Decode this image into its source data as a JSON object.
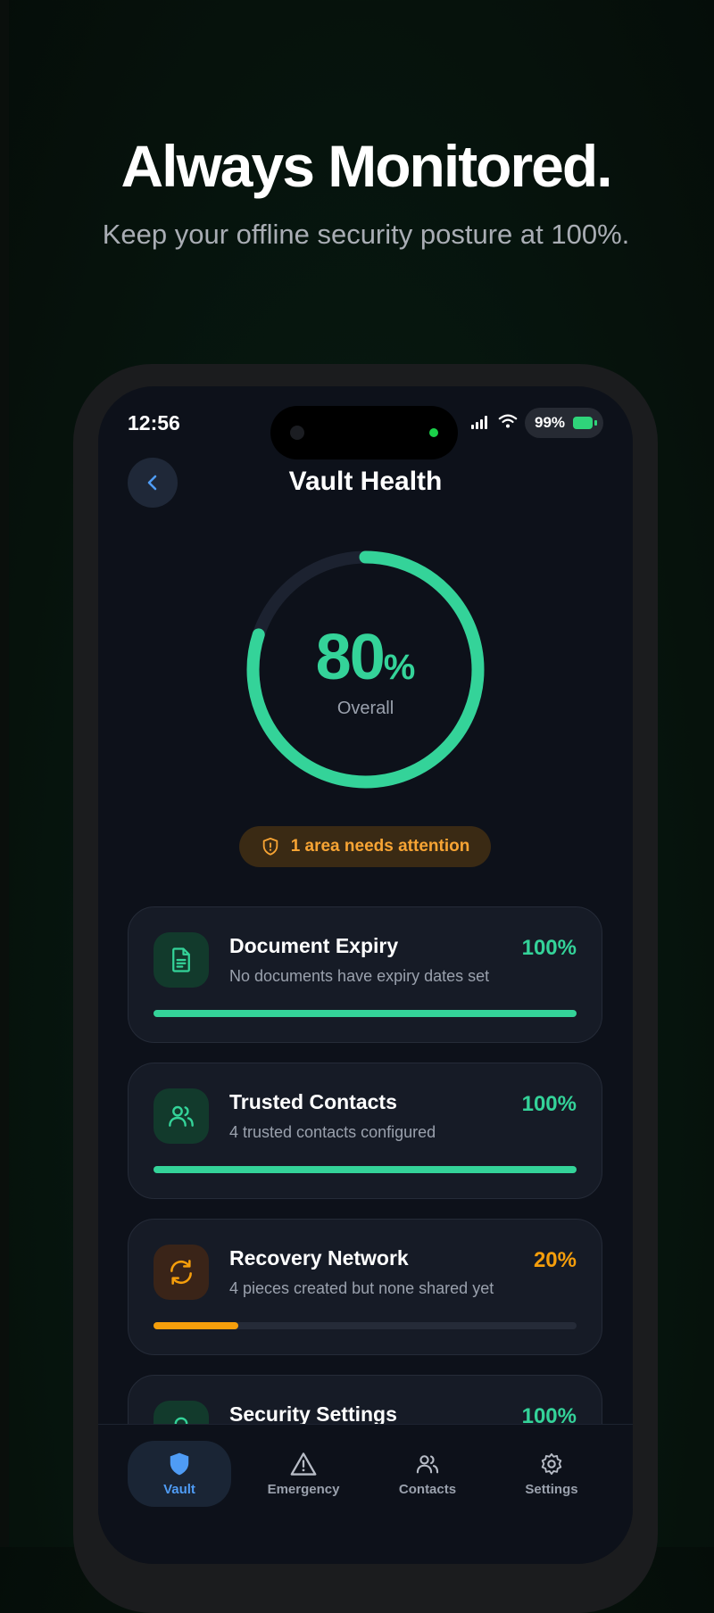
{
  "hero": {
    "title": "Always Monitored.",
    "subtitle": "Keep your offline security posture at 100%."
  },
  "status_bar": {
    "time": "12:56",
    "battery": "99%"
  },
  "header": {
    "title": "Vault Health",
    "back_icon": "chevron-left-icon"
  },
  "overall": {
    "value": "80",
    "unit": "%",
    "label": "Overall",
    "progress": 0.8
  },
  "attention": {
    "label": "1 area needs attention",
    "icon": "shield-alert-icon"
  },
  "cards": [
    {
      "title": "Document Expiry",
      "description": "No documents have expiry dates set",
      "percent_label": "100%",
      "progress": 1.0,
      "icon": "document-icon",
      "color": "#34d399"
    },
    {
      "title": "Trusted Contacts",
      "description": "4 trusted contacts configured",
      "percent_label": "100%",
      "progress": 1.0,
      "icon": "users-icon",
      "color": "#34d399"
    },
    {
      "title": "Recovery Network",
      "description": "4 pieces created but none shared yet",
      "percent_label": "20%",
      "progress": 0.2,
      "icon": "refresh-icon",
      "color": "#f59e0b"
    },
    {
      "title": "Security Settings",
      "percent_label": "100%",
      "icon": "lock-icon",
      "color": "#34d399"
    }
  ],
  "tabs": [
    {
      "label": "Vault",
      "icon": "shield-icon",
      "active": true
    },
    {
      "label": "Emergency",
      "icon": "warning-triangle-icon",
      "active": false
    },
    {
      "label": "Contacts",
      "icon": "users-icon",
      "active": false
    },
    {
      "label": "Settings",
      "icon": "gear-icon",
      "active": false
    }
  ],
  "colors": {
    "accent_green": "#34d399",
    "accent_orange": "#f59e0b",
    "active_tab_blue": "#4f9cf5",
    "screen_bg": "#0d111a"
  }
}
